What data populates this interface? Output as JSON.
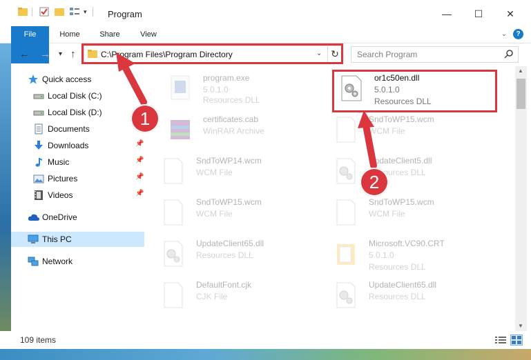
{
  "window": {
    "title": "Program",
    "controls": {
      "minimize": "—",
      "maximize": "☐",
      "close": "✕"
    }
  },
  "ribbon": {
    "tabs": [
      {
        "label": "File"
      },
      {
        "label": "Home"
      },
      {
        "label": "Share"
      },
      {
        "label": "View"
      }
    ],
    "help": "?"
  },
  "navigation": {
    "back": "←",
    "forward": "→",
    "recent": "▾",
    "up": "↑",
    "address": "C:\\Program Files\\Program Directory",
    "refresh": "↻",
    "search_placeholder": "Search Program"
  },
  "sidebar": {
    "items": [
      {
        "label": "Quick access",
        "icon": "star-icon",
        "pinned": false
      },
      {
        "label": "Local Disk (C:)",
        "icon": "drive-icon",
        "pinned": false
      },
      {
        "label": "Local Disk (D:)",
        "icon": "drive-icon",
        "pinned": false
      },
      {
        "label": "Documents",
        "icon": "documents-icon",
        "pinned": false
      },
      {
        "label": "Downloads",
        "icon": "download-icon",
        "pinned": true
      },
      {
        "label": "Music",
        "icon": "music-icon",
        "pinned": true
      },
      {
        "label": "Pictures",
        "icon": "pictures-icon",
        "pinned": true
      },
      {
        "label": "Videos",
        "icon": "videos-icon",
        "pinned": true
      },
      {
        "label": "OneDrive",
        "icon": "cloud-icon",
        "pinned": false
      },
      {
        "label": "This PC",
        "icon": "computer-icon",
        "pinned": false,
        "selected": true
      },
      {
        "label": "Network",
        "icon": "network-icon",
        "pinned": false
      }
    ]
  },
  "files": [
    {
      "name": "program.exe",
      "line2": "5.0.1.0",
      "line3": "Resources DLL",
      "icon": "exe-icon",
      "faded": true
    },
    {
      "name": "or1c50en.dll",
      "line2": "5.0.1.0",
      "line3": "Resources DLL",
      "icon": "dll-gear-icon",
      "faded": false
    },
    {
      "name": "certificates.cab",
      "line2": "WinRAR Archive",
      "line3": "",
      "icon": "winrar-icon",
      "faded": true
    },
    {
      "name": "SndToWP15.wcm",
      "line2": "WCM File",
      "line3": "",
      "icon": "blank-file-icon",
      "faded": true
    },
    {
      "name": "SndToWP14.wcm",
      "line2": "WCM File",
      "line3": "",
      "icon": "blank-file-icon",
      "faded": true
    },
    {
      "name": "UpdateClient5.dll",
      "line2": "Resources DLL",
      "line3": "",
      "icon": "dll-gear-icon",
      "faded": true
    },
    {
      "name": "SndToWP15.wcm",
      "line2": "WCM File",
      "line3": "",
      "icon": "blank-file-icon",
      "faded": true
    },
    {
      "name": "SndToWP15.wcm",
      "line2": "WCM File",
      "line3": "",
      "icon": "blank-file-icon",
      "faded": true
    },
    {
      "name": "UpdateClient65.dll",
      "line2": "Resources DLL",
      "line3": "",
      "icon": "dll-gear-icon",
      "faded": true
    },
    {
      "name": "Microsoft.VC90.CRT",
      "line2": "5.0.1.0",
      "line3": "Resources DLL",
      "icon": "folder-file-icon",
      "faded": true
    },
    {
      "name": "DefaultFont.cjk",
      "line2": "CJK File",
      "line3": "",
      "icon": "blank-file-icon",
      "faded": true
    },
    {
      "name": "UpdateClient65.dll",
      "line2": "Resources DLL",
      "line3": "",
      "icon": "dll-gear-icon",
      "faded": true
    }
  ],
  "status": {
    "item_count": "109 items"
  },
  "annotations": [
    {
      "number": "1",
      "color": "#d9363e"
    },
    {
      "number": "2",
      "color": "#d9363e"
    }
  ],
  "colors": {
    "accent": "#1979ca",
    "highlight": "#d9363e",
    "selection": "#cce8ff"
  }
}
